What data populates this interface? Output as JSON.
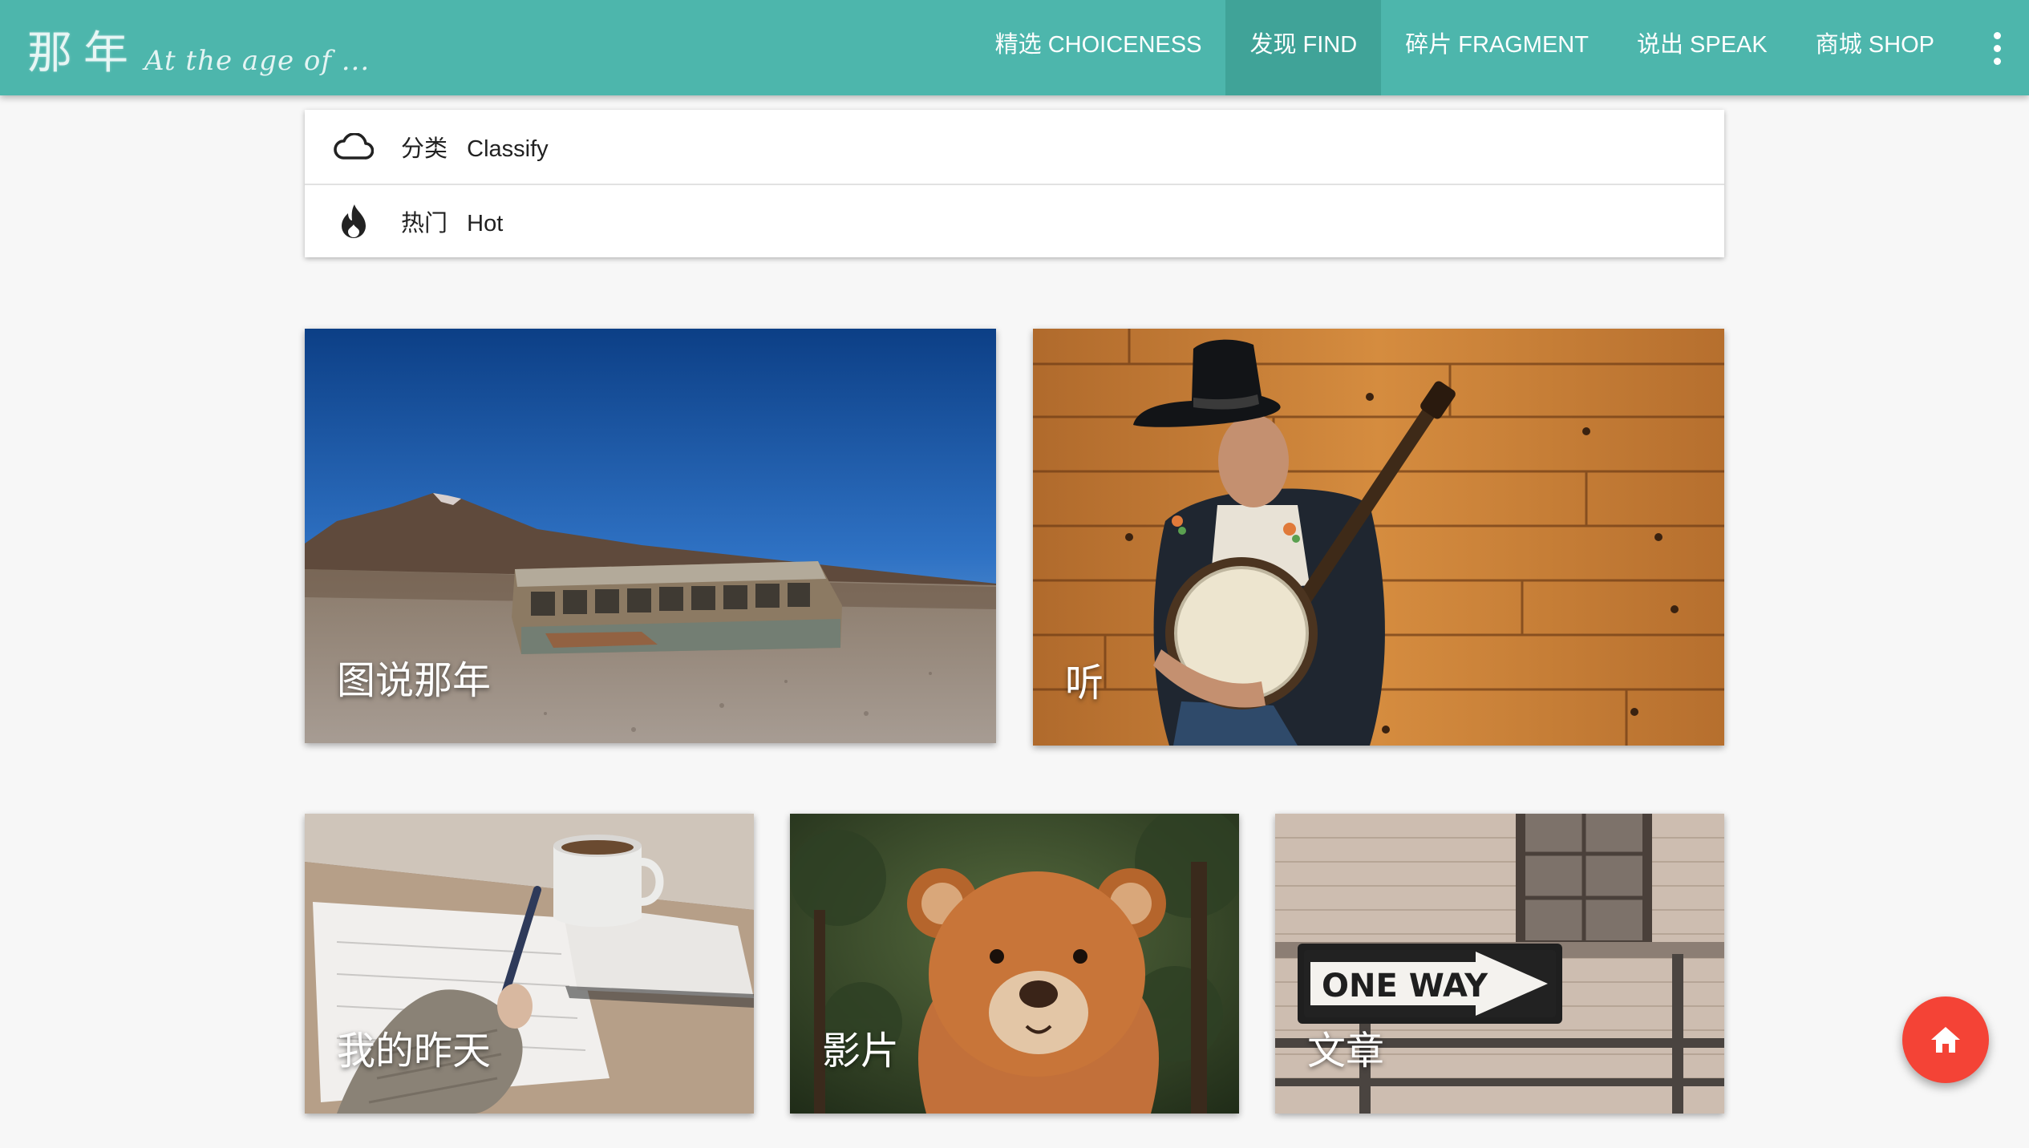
{
  "header": {
    "logo_cn": "那年",
    "logo_en": "At the age of ...",
    "nav": [
      {
        "label": "精选 CHOICENESS"
      },
      {
        "label": "发现 FIND",
        "active": true
      },
      {
        "label": "碎片 FRAGMENT"
      },
      {
        "label": "说出 SPEAK"
      },
      {
        "label": "商城 SHOP"
      }
    ],
    "more_icon": "more-vert-icon"
  },
  "menu": {
    "items": [
      {
        "icon": "cloud-icon",
        "label": "分类   Classify"
      },
      {
        "icon": "fire-icon",
        "label": "热门   Hot"
      }
    ]
  },
  "cards": [
    {
      "title": "图说那年"
    },
    {
      "title": "听"
    },
    {
      "title": "我的昨天"
    },
    {
      "title": "影片"
    },
    {
      "title": "文章",
      "sign_text": "ONE WAY"
    }
  ],
  "fab": {
    "icon": "home-icon"
  },
  "colors": {
    "header": "#4db6ac",
    "header_active": "#40a398",
    "fab": "#f44336",
    "background": "#f7f7f7"
  }
}
